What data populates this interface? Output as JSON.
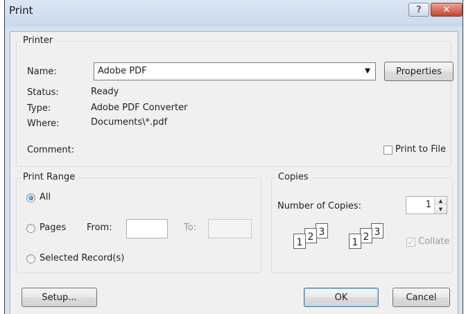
{
  "window": {
    "title": "Print",
    "help_glyph": "?",
    "close_glyph": "✕"
  },
  "printer": {
    "legend": "Printer",
    "name_label": "Name:",
    "name_value": "Adobe PDF",
    "properties_label": "Properties",
    "status_label": "Status:",
    "status_value": "Ready",
    "type_label": "Type:",
    "type_value": "Adobe PDF Converter",
    "where_label": "Where:",
    "where_value": "Documents\\*.pdf",
    "comment_label": "Comment:",
    "print_to_file_label": "Print to File",
    "print_to_file_checked": false
  },
  "range": {
    "legend": "Print Range",
    "all_label": "All",
    "pages_label": "Pages",
    "from_label": "From:",
    "to_label": "To:",
    "selected_label": "Selected Record(s)",
    "selected_option": "All"
  },
  "copies": {
    "legend": "Copies",
    "number_label": "Number of Copies:",
    "number_value": "1",
    "collate_label": "Collate",
    "collate_checked": true,
    "page_numbers": [
      "1",
      "2",
      "3"
    ]
  },
  "buttons": {
    "setup": "Setup...",
    "ok": "OK",
    "cancel": "Cancel"
  }
}
